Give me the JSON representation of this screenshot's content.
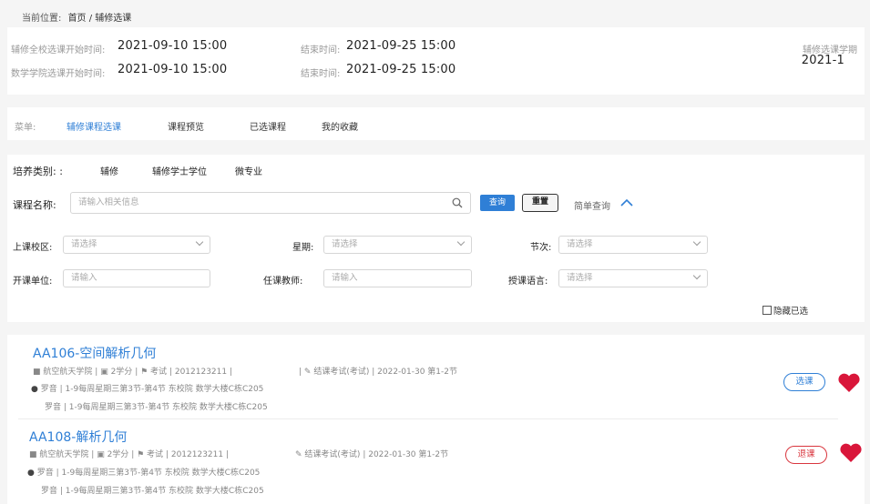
{
  "breadcrumb": {
    "label": "当前位置:",
    "path": "首页 / 辅修选课"
  },
  "times": {
    "row1": {
      "label": "辅修全校选课开始时间:",
      "start": "2021-09-10 15:00",
      "end_label": "结束时间:",
      "end": "2021-09-25 15:00"
    },
    "row2": {
      "label": "数学学院选课开始时间:",
      "start": "2021-09-10 15:00",
      "end_label": "结束时间:",
      "end": "2021-09-25 15:00"
    },
    "term_label": "辅修选课学期",
    "term": "2021-1"
  },
  "menu": {
    "label": "菜单:",
    "items": [
      "辅修课程选课",
      "课程预览",
      "已选课程",
      "我的收藏"
    ]
  },
  "category": {
    "label": "培养类别: :",
    "options": [
      "辅修",
      "辅修学士学位",
      "微专业"
    ]
  },
  "search": {
    "label": "课程名称:",
    "placeholder": "请输入相关信息",
    "query_btn": "查询",
    "reset_btn": "重置",
    "toggle_label": "简单查询"
  },
  "filters": {
    "campus": {
      "label": "上课校区:",
      "placeholder": "请选择"
    },
    "weekday": {
      "label": "星期:",
      "placeholder": "请选择"
    },
    "period": {
      "label": "节次:",
      "placeholder": "请选择"
    },
    "dept": {
      "label": "开课单位:",
      "placeholder": "请输入"
    },
    "teacher": {
      "label": "任课教师:",
      "placeholder": "请输入"
    },
    "language": {
      "label": "授课语言:",
      "placeholder": "请选择"
    },
    "hide_selected": "隐藏已选"
  },
  "courses": [
    {
      "title": "AA106-空间解析几何",
      "college": "航空航天学院",
      "credit": "2学分",
      "assess": "考试",
      "code": "2012123211",
      "exam": "结课考试(考试)",
      "exam_date": "2022-01-30 第1-2节",
      "teacher": "罗音",
      "schedule1": "1-9每周星期三第3节-第4节 东校院 数学大楼C栋C205",
      "schedule2": "1-9每周星期三第3节-第4节 东校院 数学大楼C栋C205",
      "action": "选课",
      "action_color": "#2f7fd6"
    },
    {
      "title": "AA108-解析几何",
      "college": "航空航天学院",
      "credit": "2学分",
      "assess": "考试",
      "code": "2012123211",
      "exam": "结课考试(考试)",
      "exam_date": "2022-01-30 第1-2节",
      "teacher": "罗音",
      "schedule1": "1-9每周星期三第3节-第4节 东校院 数学大楼C栋C205",
      "schedule2": "1-9每周星期三第3节-第4节 东校院 数学大楼C栋C205",
      "action": "退课",
      "action_color": "#d9363e"
    }
  ],
  "colors": {
    "accent": "#2f7fd6",
    "heart": "#d9163a"
  }
}
